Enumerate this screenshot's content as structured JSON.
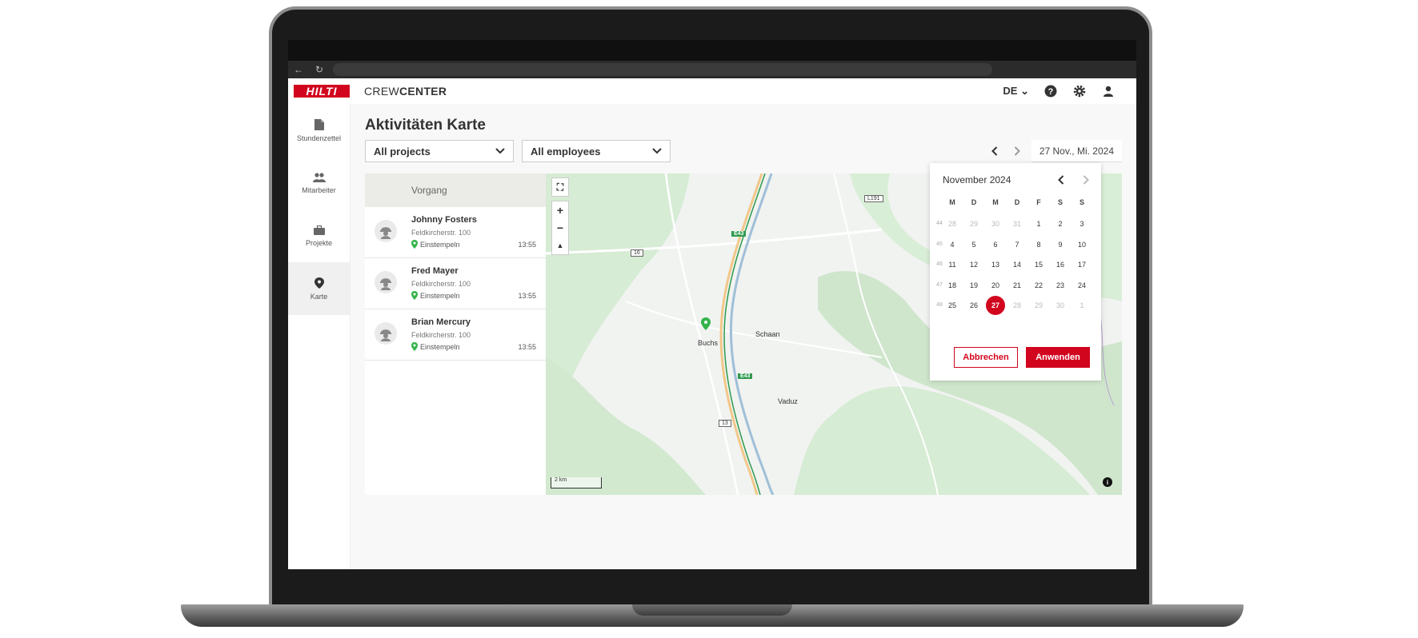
{
  "app": {
    "logo_text": "HILTI",
    "title_light": "CREW",
    "title_bold": "CENTER",
    "language": "DE",
    "icons": [
      "help-icon",
      "gear-icon",
      "user-icon"
    ]
  },
  "sidebar": {
    "items": [
      {
        "label": "Stundenzettel",
        "icon": "document-icon"
      },
      {
        "label": "Mitarbeiter",
        "icon": "people-icon"
      },
      {
        "label": "Projekte",
        "icon": "briefcase-icon"
      },
      {
        "label": "Karte",
        "icon": "map-pin-icon",
        "active": true
      }
    ]
  },
  "page": {
    "title": "Aktivitäten Karte",
    "project_filter": "All projects",
    "employee_filter": "All employees",
    "date": "27 Nov., Mi. 2024"
  },
  "list": {
    "header": "Vorgang",
    "rows": [
      {
        "name": "Johnny Fosters",
        "address": "Feldkircherstr. 100",
        "status": "Einstempeln",
        "time": "13:55"
      },
      {
        "name": "Fred Mayer",
        "address": "Feldkircherstr. 100",
        "status": "Einstempeln",
        "time": "13:55"
      },
      {
        "name": "Brian Mercury",
        "address": "Feldkircherstr. 100",
        "status": "Einstempeln",
        "time": "13:55"
      }
    ]
  },
  "map": {
    "places": {
      "buchs": "Buchs",
      "schaan": "Schaan",
      "vaduz": "Vaduz"
    },
    "roads": {
      "r16": "16",
      "r13": "13",
      "l191": "L191",
      "e43a": "E43",
      "e43b": "E43"
    },
    "scale": "2 km",
    "controls": {
      "zoom_in": "+",
      "zoom_out": "−"
    },
    "colors": {
      "green": "#cfe8cd",
      "marker": "#34b44a"
    }
  },
  "calendar": {
    "month": "November 2024",
    "weekdays": [
      "M",
      "D",
      "M",
      "D",
      "F",
      "S",
      "S"
    ],
    "weeks": [
      {
        "num": "44",
        "days": [
          {
            "d": "28",
            "m": true
          },
          {
            "d": "29",
            "m": true
          },
          {
            "d": "30",
            "m": true
          },
          {
            "d": "31",
            "m": true
          },
          {
            "d": "1"
          },
          {
            "d": "2"
          },
          {
            "d": "3"
          }
        ]
      },
      {
        "num": "45",
        "days": [
          {
            "d": "4"
          },
          {
            "d": "5"
          },
          {
            "d": "6"
          },
          {
            "d": "7"
          },
          {
            "d": "8"
          },
          {
            "d": "9"
          },
          {
            "d": "10"
          }
        ]
      },
      {
        "num": "46",
        "days": [
          {
            "d": "11"
          },
          {
            "d": "12"
          },
          {
            "d": "13"
          },
          {
            "d": "14"
          },
          {
            "d": "15"
          },
          {
            "d": "16"
          },
          {
            "d": "17"
          }
        ]
      },
      {
        "num": "47",
        "days": [
          {
            "d": "18"
          },
          {
            "d": "19"
          },
          {
            "d": "20"
          },
          {
            "d": "21"
          },
          {
            "d": "22"
          },
          {
            "d": "23"
          },
          {
            "d": "24"
          }
        ]
      },
      {
        "num": "48",
        "days": [
          {
            "d": "25"
          },
          {
            "d": "26"
          },
          {
            "d": "27",
            "sel": true
          },
          {
            "d": "28",
            "m": true
          },
          {
            "d": "29",
            "m": true
          },
          {
            "d": "30",
            "m": true
          },
          {
            "d": "1",
            "m": true
          }
        ]
      }
    ],
    "cancel_label": "Abbrechen",
    "apply_label": "Anwenden",
    "accent": "#d2051e"
  }
}
